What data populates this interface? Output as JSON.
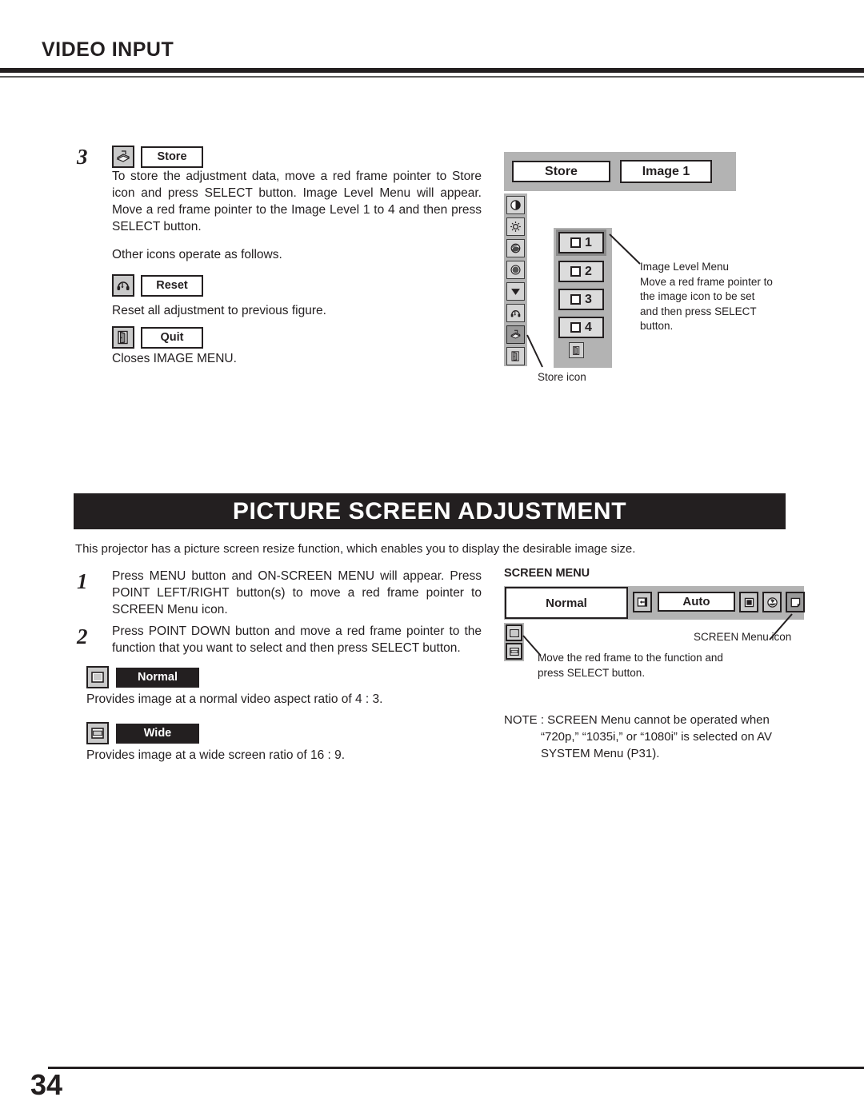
{
  "header": {
    "title": "VIDEO INPUT"
  },
  "step3": {
    "number": "3",
    "icon_label": "Store",
    "icon_name": "store-icon",
    "body": "To store the adjustment data, move a red frame pointer to Store icon and press SELECT button.  Image Level Menu will appear. Move a red frame pointer to the Image Level 1 to 4 and then press SELECT button.",
    "other_icons_line": "Other icons operate as follows.",
    "reset_label": "Reset",
    "reset_desc": "Reset all adjustment to previous figure.",
    "quit_label": "Quit",
    "quit_desc": "Closes IMAGE MENU."
  },
  "store_osd": {
    "store_field": "Store",
    "image_field": "Image 1",
    "sidebar_icons": [
      "contrast-icon",
      "brightness-icon",
      "color-icon",
      "tint-icon",
      "sharpness-icon",
      "reset-icon",
      "store-icon",
      "quit-icon"
    ],
    "levels": [
      "1",
      "2",
      "3",
      "4"
    ],
    "selected_level": "1",
    "callout_level": "Image Level Menu\nMove a red frame pointer to the image icon to be set and then press SELECT button.",
    "callout_level_lines": [
      "Image Level Menu",
      "Move a red frame pointer to",
      "the image icon to be set",
      "and then press SELECT",
      "button."
    ],
    "callout_store_icon": "Store icon"
  },
  "banner": {
    "title": "PICTURE SCREEN ADJUSTMENT"
  },
  "intro": {
    "text": "This projector has a picture screen resize function, which enables you to display the desirable image size."
  },
  "step1": {
    "number": "1",
    "body": "Press MENU button and ON-SCREEN MENU will appear.  Press POINT LEFT/RIGHT button(s) to move a red frame pointer to SCREEN Menu icon."
  },
  "step2": {
    "number": "2",
    "body": "Press POINT DOWN button and move a red frame pointer to the function that you want to select and then press SELECT button."
  },
  "options": {
    "normal_label": "Normal",
    "normal_desc": "Provides image at a normal video aspect ratio of 4 : 3.",
    "wide_label": "Wide",
    "wide_desc": "Provides image at a wide screen ratio of 16 : 9."
  },
  "screen_menu": {
    "title": "SCREEN MENU",
    "normal_field": "Normal",
    "auto_field": "Auto",
    "bar_icons": [
      "input-source-icon",
      "screen-square-icon",
      "image-adjust-icon",
      "screen-menu-icon"
    ],
    "left_icons": [
      "normal-screen-icon",
      "wide-screen-icon"
    ],
    "callout_screen_menu_icon": "SCREEN Menu icon",
    "callout_move_frame_lines": [
      "Move the red frame to the function and",
      "press SELECT button."
    ],
    "note_prefix": "NOTE : ",
    "note_line1": "SCREEN Menu cannot be operated when",
    "note_line2": "“720p,” “1035i,” or “1080i” is selected on AV",
    "note_line3": "SYSTEM Menu (P31)."
  },
  "footer": {
    "page_number": "34"
  },
  "colors": {
    "ink": "#231f20",
    "osd_gray": "#b3b3b3",
    "icon_gray": "#c9c9c9"
  }
}
